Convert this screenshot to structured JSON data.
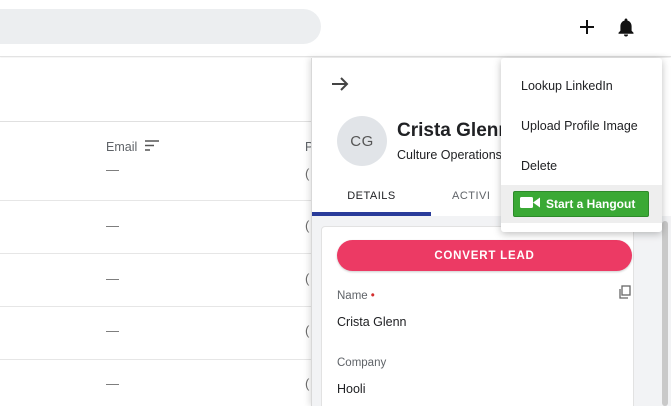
{
  "header": {
    "add_icon": "plus-icon",
    "notification_icon": "bell-icon"
  },
  "list": {
    "columns": {
      "email": "Email",
      "phone_partial": "P"
    },
    "sort_icon": "sort-icon",
    "rows": [
      {
        "email": "—",
        "phone_partial": "("
      },
      {
        "email": "—",
        "phone_partial": "("
      },
      {
        "email": "—",
        "phone_partial": "("
      },
      {
        "email": "—",
        "phone_partial": "("
      },
      {
        "email": "—",
        "phone_partial": "("
      }
    ]
  },
  "panel": {
    "back_icon": "arrow-right-icon",
    "avatar_initials": "CG",
    "name": "Crista Glenn",
    "title": "Culture Operations",
    "tabs": [
      "DETAILS",
      "ACTIVI"
    ],
    "convert_label": "CONVERT LEAD",
    "fields": [
      {
        "label": "Name",
        "required_mark": "•",
        "value": "Crista Glenn"
      },
      {
        "label": "Company",
        "value": "Hooli"
      }
    ],
    "copy_icon": "copy-icon"
  },
  "menu": {
    "items": [
      "Lookup LinkedIn",
      "Upload Profile Image",
      "Delete"
    ],
    "hangout_label": "Start a Hangout",
    "hangout_icon": "video-camera-icon"
  },
  "colors": {
    "accent_pink": "#ec3a64",
    "tab_indicator": "#2a3c9a",
    "hangout_green": "#3aa935"
  }
}
